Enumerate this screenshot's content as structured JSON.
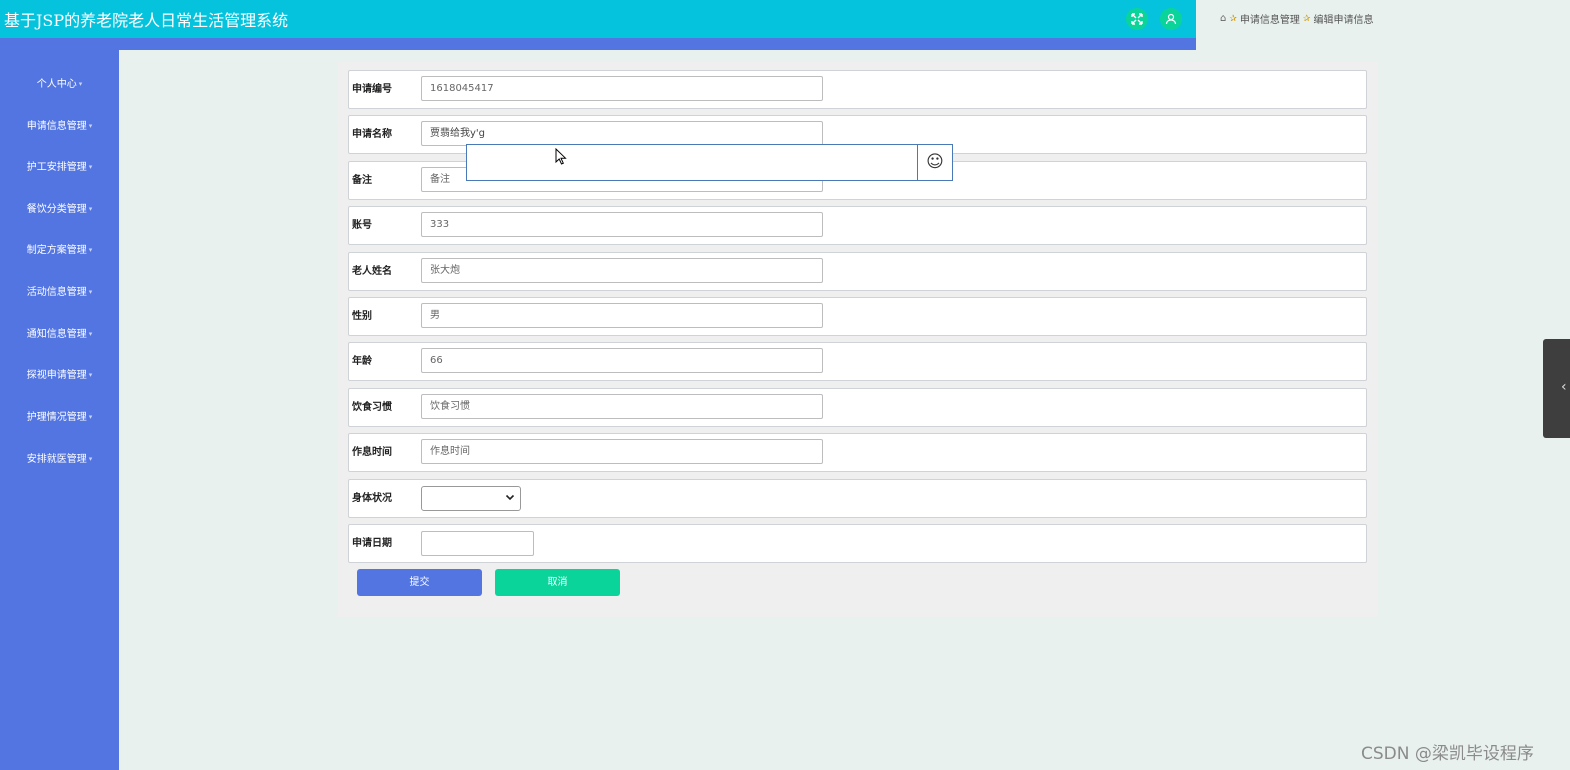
{
  "header": {
    "title": "基于JSP的养老院老人日常生活管理系统",
    "icons": [
      "fullscreen-icon",
      "user-icon"
    ]
  },
  "breadcrumb": {
    "level1": "申请信息管理",
    "level2": "编辑申请信息"
  },
  "sidebar": {
    "items": [
      {
        "label": "个人中心"
      },
      {
        "label": "申请信息管理"
      },
      {
        "label": "护工安排管理"
      },
      {
        "label": "餐饮分类管理"
      },
      {
        "label": "制定方案管理"
      },
      {
        "label": "活动信息管理"
      },
      {
        "label": "通知信息管理"
      },
      {
        "label": "探视申请管理"
      },
      {
        "label": "护理情况管理"
      },
      {
        "label": "安排就医管理"
      }
    ]
  },
  "form": {
    "fields": [
      {
        "label": "申请编号",
        "value": "1618045417"
      },
      {
        "label": "申请名称",
        "value": "贾翡给我y'g"
      },
      {
        "label": "备注",
        "placeholder": "备注"
      },
      {
        "label": "账号",
        "value": "333"
      },
      {
        "label": "老人姓名",
        "value": "张大炮"
      },
      {
        "label": "性别",
        "value": "男"
      },
      {
        "label": "年龄",
        "value": "66"
      },
      {
        "label": "饮食习惯",
        "placeholder": "饮食习惯"
      },
      {
        "label": "作息时间",
        "placeholder": "作息时间"
      },
      {
        "label": "身体状况",
        "value": ""
      },
      {
        "label": "申请日期",
        "value": ""
      }
    ],
    "submit_label": "提交",
    "cancel_label": "取消"
  },
  "ime_popup": {
    "emoji_icon": "smiley-icon"
  },
  "watermark": "CSDN @梁凯毕设程序"
}
